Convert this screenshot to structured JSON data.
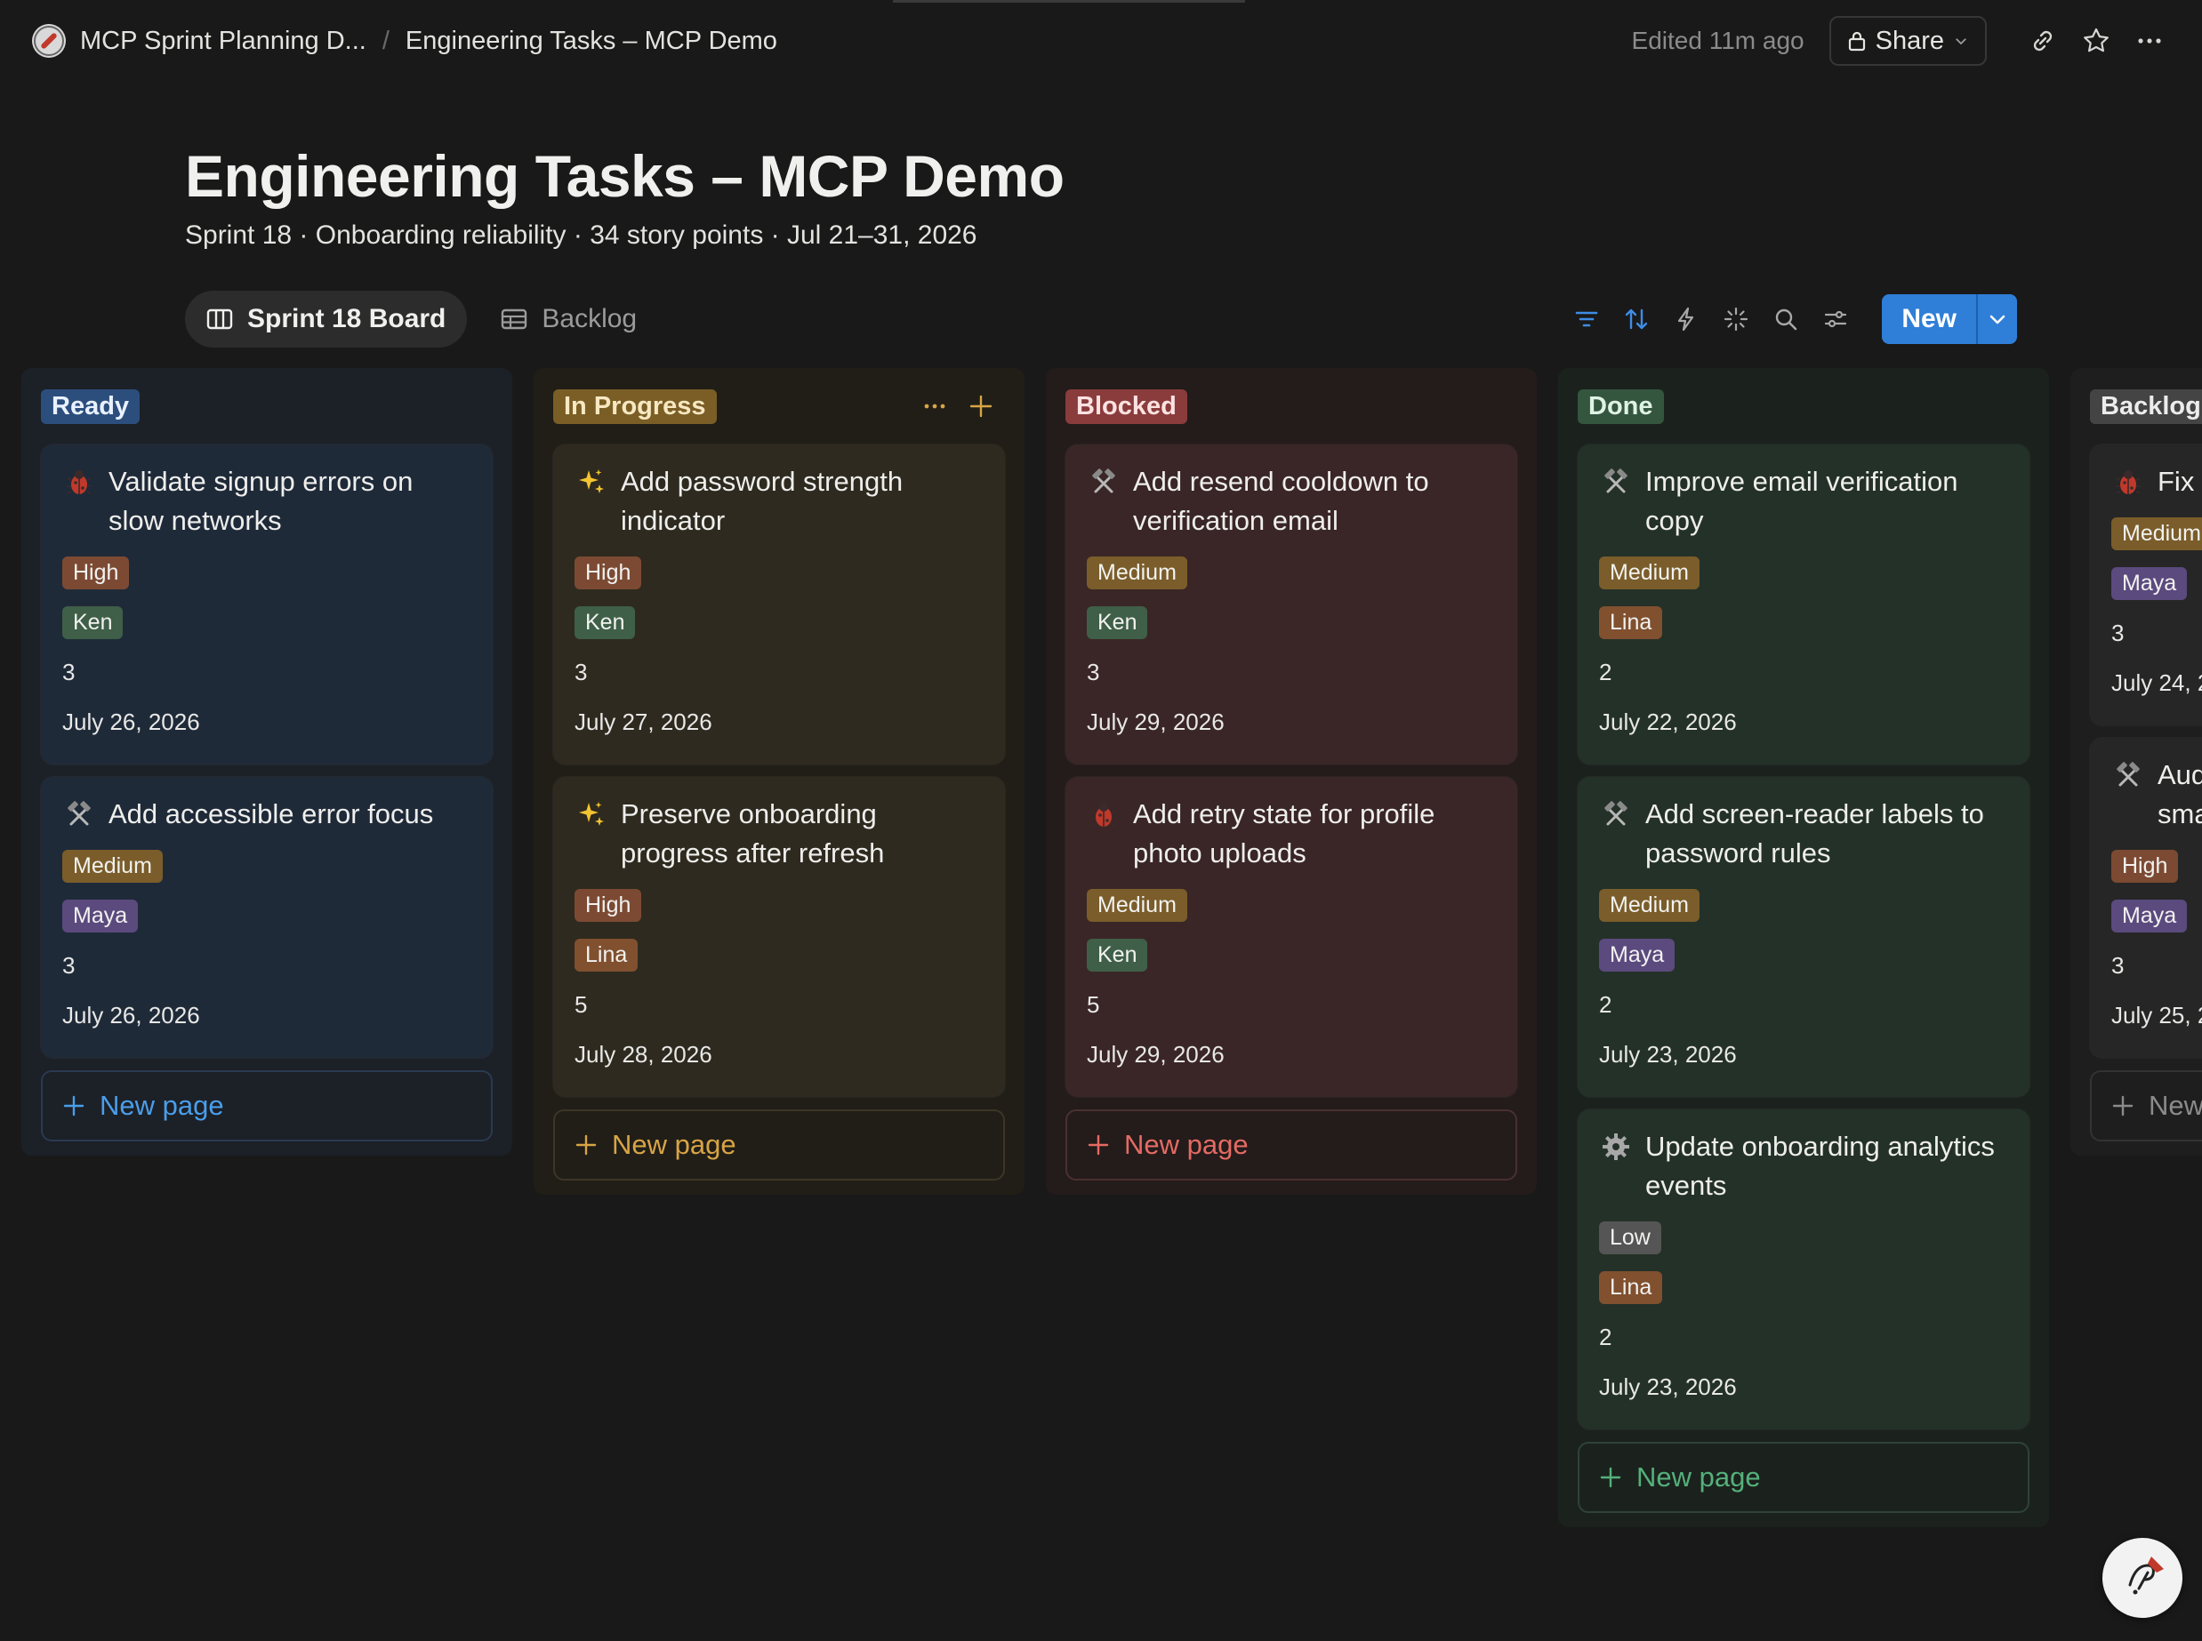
{
  "topbar": {
    "workspace_crumb": "MCP Sprint Planning D...",
    "page_crumb": "Engineering Tasks – MCP Demo",
    "edited": "Edited 11m ago",
    "share_label": "Share"
  },
  "header": {
    "title": "Engineering Tasks – MCP Demo",
    "subtitle": "Sprint 18 · Onboarding reliability · 34 story points · Jul 21–31, 2026"
  },
  "views": {
    "board_label": "Sprint 18 Board",
    "backlog_label": "Backlog"
  },
  "toolbar": {
    "new_label": "New",
    "icons": [
      "filter-icon",
      "sort-icon",
      "automation-icon",
      "ai-sparkle-icon",
      "search-icon",
      "settings-sliders-icon"
    ]
  },
  "board": {
    "new_page_label": "New page",
    "columns": [
      {
        "label": "Ready",
        "cards": [
          {
            "icon": "bug-icon",
            "title": "Validate signup errors on slow networks",
            "priority": "High",
            "assignee": "Ken",
            "points": "3",
            "date": "July 26, 2026"
          },
          {
            "icon": "hammer-icon",
            "title": "Add accessible error focus",
            "priority": "Medium",
            "assignee": "Maya",
            "points": "3",
            "date": "July 26, 2026"
          }
        ]
      },
      {
        "label": "In Progress",
        "cards": [
          {
            "icon": "sparkles-icon",
            "title": "Add password strength indicator",
            "priority": "High",
            "assignee": "Ken",
            "points": "3",
            "date": "July 27, 2026"
          },
          {
            "icon": "sparkles-icon",
            "title": "Preserve onboarding progress after refresh",
            "priority": "High",
            "assignee": "Lina",
            "points": "5",
            "date": "July 28, 2026"
          }
        ]
      },
      {
        "label": "Blocked",
        "cards": [
          {
            "icon": "hammer-icon",
            "title": "Add resend cooldown to verification email",
            "priority": "Medium",
            "assignee": "Ken",
            "points": "3",
            "date": "July 29, 2026"
          },
          {
            "icon": "bug-icon",
            "title": "Add retry state for profile photo uploads",
            "priority": "Medium",
            "assignee": "Ken",
            "points": "5",
            "date": "July 29, 2026"
          }
        ]
      },
      {
        "label": "Done",
        "cards": [
          {
            "icon": "hammer-icon",
            "title": "Improve email verification copy",
            "priority": "Medium",
            "assignee": "Lina",
            "points": "2",
            "date": "July 22, 2026"
          },
          {
            "icon": "hammer-icon",
            "title": "Add screen-reader labels to password rules",
            "priority": "Medium",
            "assignee": "Maya",
            "points": "2",
            "date": "July 23, 2026"
          },
          {
            "icon": "gear-icon",
            "title": "Update onboarding analytics events",
            "priority": "Low",
            "assignee": "Lina",
            "points": "2",
            "date": "July 23, 2026"
          }
        ]
      },
      {
        "label": "Backlog",
        "cards": [
          {
            "icon": "bug-icon",
            "title_visible": "Fix r",
            "priority": "Medium",
            "assignee": "Maya",
            "points": "3",
            "date_visible": "July 24, 2"
          },
          {
            "icon": "hammer-icon",
            "title_visible_line1": "Audi",
            "title_visible_line2": "sma",
            "priority": "High",
            "assignee": "Maya",
            "points": "3",
            "date_visible": "July 25, 2"
          }
        ],
        "new_page_visible": "New"
      }
    ]
  },
  "colors": {
    "background": "#191919",
    "accent_blue": "#2f7ed8"
  }
}
